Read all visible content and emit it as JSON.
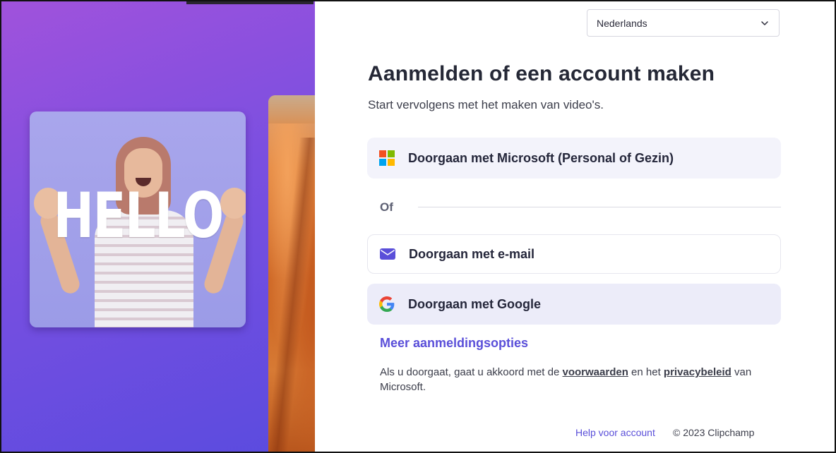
{
  "language_select": {
    "value": "Nederlands",
    "icon": "chevron-down-icon"
  },
  "hero": {
    "hello_text": "HELLO"
  },
  "header": {
    "title": "Aanmelden of een account maken",
    "subtitle": "Start vervolgens met het maken van video's."
  },
  "auth": {
    "microsoft_label": "Doorgaan met Microsoft (Personal of Gezin)",
    "divider_label": "Of",
    "email_label": "Doorgaan met e-mail",
    "google_label": "Doorgaan met Google",
    "more_options_label": "Meer aanmeldingsopties"
  },
  "terms": {
    "prefix": "Als u doorgaat, gaat u akkoord met de ",
    "terms_link": "voorwaarden",
    "middle": " en het ",
    "privacy_link": "privacybeleid",
    "suffix": " van Microsoft."
  },
  "footer": {
    "help_label": "Help voor account",
    "copyright": "© 2023 Clipchamp"
  },
  "colors": {
    "accent": "#5a4fd9",
    "hero_gradient_start": "#a052dc",
    "hero_gradient_end": "#5a4bdf",
    "microsoft_red": "#f25022",
    "microsoft_green": "#7fba00",
    "microsoft_blue": "#00a4ef",
    "microsoft_yellow": "#ffb900"
  }
}
